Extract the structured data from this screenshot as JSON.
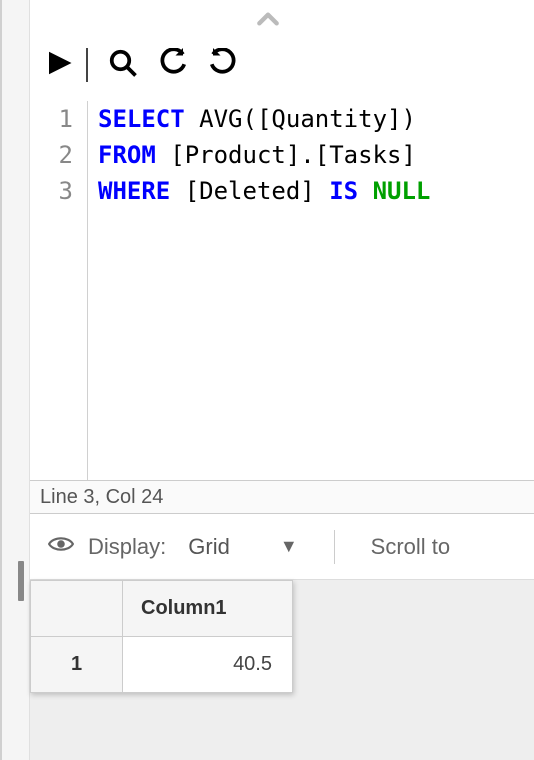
{
  "collapse_icon": "chevron-up",
  "toolbar": {
    "play": "play",
    "search": "search",
    "undo": "undo",
    "redo": "redo"
  },
  "editor": {
    "lines": [
      {
        "num": "1",
        "tokens": [
          {
            "t": "SELECT",
            "c": "kw"
          },
          {
            "t": " ",
            "c": ""
          },
          {
            "t": "AVG",
            "c": "fn"
          },
          {
            "t": "(",
            "c": "op"
          },
          {
            "t": "[Quantity]",
            "c": "id"
          },
          {
            "t": ")",
            "c": "op"
          }
        ]
      },
      {
        "num": "2",
        "tokens": [
          {
            "t": "FROM",
            "c": "kw"
          },
          {
            "t": " ",
            "c": ""
          },
          {
            "t": "[Product]",
            "c": "id"
          },
          {
            "t": ".",
            "c": "op"
          },
          {
            "t": "[Tasks]",
            "c": "id"
          }
        ]
      },
      {
        "num": "3",
        "tokens": [
          {
            "t": "WHERE",
            "c": "kw"
          },
          {
            "t": " ",
            "c": ""
          },
          {
            "t": "[Deleted]",
            "c": "id"
          },
          {
            "t": " ",
            "c": ""
          },
          {
            "t": "IS",
            "c": "is"
          },
          {
            "t": " ",
            "c": ""
          },
          {
            "t": "NULL",
            "c": "null"
          }
        ]
      }
    ]
  },
  "status": {
    "text": "Line 3, Col 24"
  },
  "results": {
    "display_label": "Display:",
    "display_value": "Grid",
    "scroll_label": "Scroll to",
    "columns": [
      "Column1"
    ],
    "rows": [
      {
        "num": "1",
        "cells": [
          "40.5"
        ]
      }
    ]
  }
}
